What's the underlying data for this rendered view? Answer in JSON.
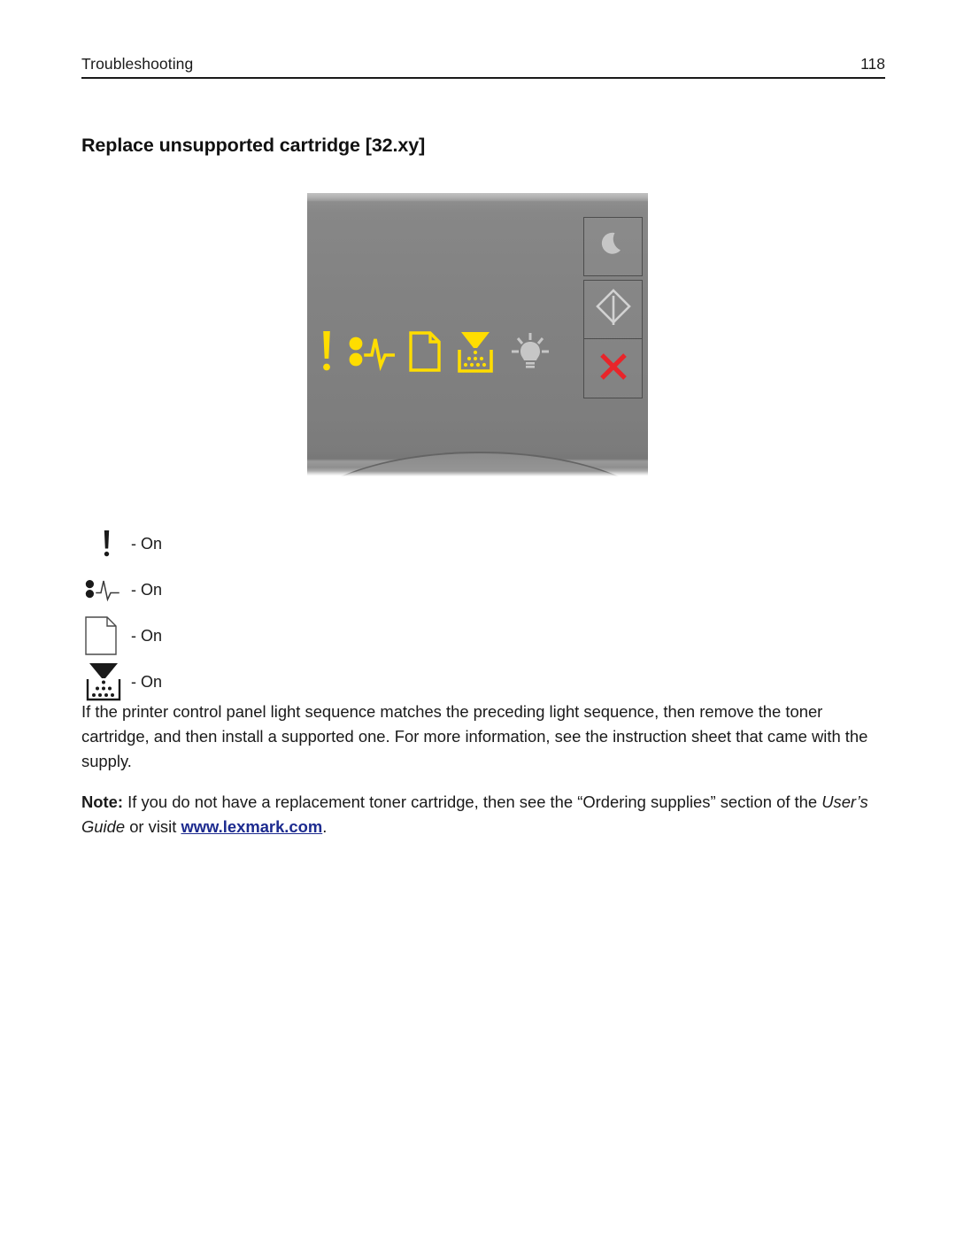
{
  "header": {
    "title": "Troubleshooting",
    "page_number": "118"
  },
  "heading": "Replace unsupported cartridge [32.xy]",
  "control_panel": {
    "name": "printer-control-panel",
    "lights": [
      {
        "id": "error",
        "icon": "exclamation-error-icon",
        "state": "on",
        "color": "#FFDD00"
      },
      {
        "id": "jam",
        "icon": "paper-jam-icon",
        "state": "on",
        "color": "#FFDD00"
      },
      {
        "id": "paper",
        "icon": "load-paper-icon",
        "state": "on",
        "color": "#FFDD00"
      },
      {
        "id": "toner",
        "icon": "low-toner-icon",
        "state": "on",
        "color": "#FFDD00"
      },
      {
        "id": "ready",
        "icon": "ready-lightbulb-icon",
        "state": "off",
        "color": "#C6C6C6"
      }
    ],
    "buttons": [
      {
        "id": "sleep",
        "icon": "moon-sleep-icon",
        "color": "#C6C6C6"
      },
      {
        "id": "start",
        "icon": "start-diamond-icon",
        "color": "#D2D2D2"
      },
      {
        "id": "cancel",
        "icon": "cancel-x-icon",
        "color": "#E8252A"
      }
    ]
  },
  "legend": {
    "rows": [
      {
        "icon": "exclamation-error-icon",
        "label": "- On"
      },
      {
        "icon": "paper-jam-icon",
        "label": "- On"
      },
      {
        "icon": "load-paper-icon",
        "label": "- On"
      },
      {
        "icon": "low-toner-icon",
        "label": "- On"
      }
    ]
  },
  "body": {
    "paragraph1": "If the printer control panel light sequence matches the preceding light sequence, then remove the toner cartridge, and then install a supported one. For more information, see the instruction sheet that came with the supply.",
    "note_label": "Note:",
    "note_text_before": " If you do not have a replacement toner cartridge, then see the “Ordering supplies” section of the ",
    "note_italic": "User’s Guide",
    "note_text_middle": " or visit ",
    "note_link": "www.lexmark.com",
    "note_text_after": "."
  }
}
